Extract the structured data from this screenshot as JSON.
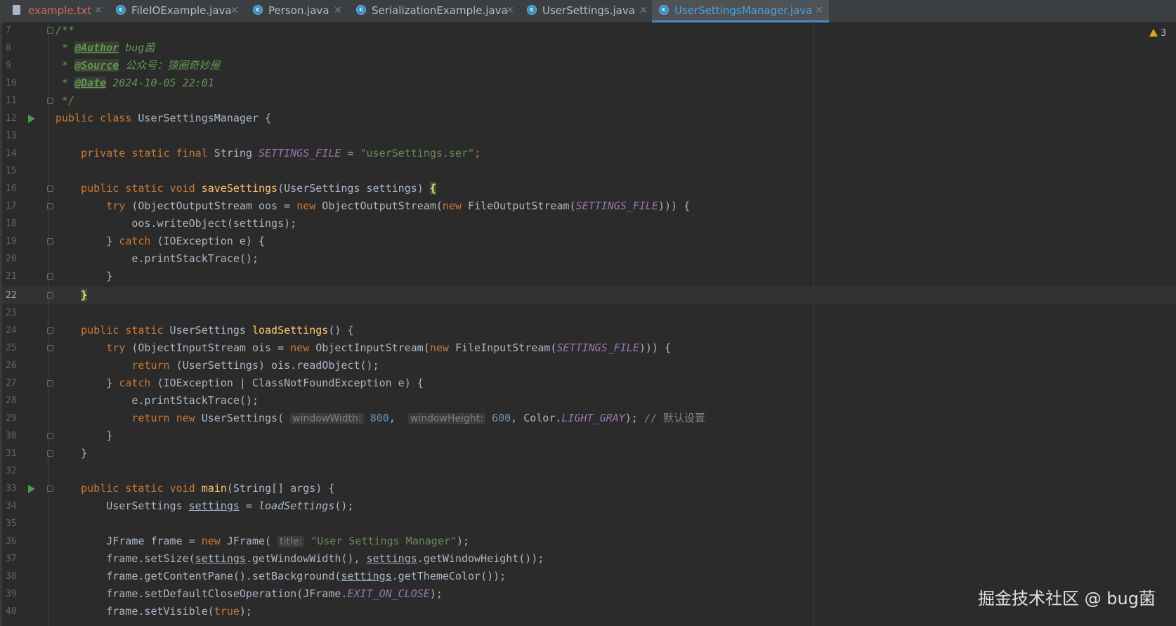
{
  "tabs": [
    {
      "label": "example.txt",
      "icon": "file-icon"
    },
    {
      "label": "FileIOExample.java",
      "icon": "java-class-icon"
    },
    {
      "label": "Person.java",
      "icon": "java-class-icon"
    },
    {
      "label": "SerializationExample.java",
      "icon": "java-class-icon"
    },
    {
      "label": "UserSettings.java",
      "icon": "java-class-icon"
    },
    {
      "label": "UserSettingsManager.java",
      "icon": "java-class-icon",
      "active": true
    }
  ],
  "warnings_count": "3",
  "watermark": "掘金技术社区 @ bug菌",
  "current_line": "22",
  "lines": [
    {
      "n": "7"
    },
    {
      "n": "8"
    },
    {
      "n": "9"
    },
    {
      "n": "10"
    },
    {
      "n": "11"
    },
    {
      "n": "12"
    },
    {
      "n": "13"
    },
    {
      "n": "14"
    },
    {
      "n": "15"
    },
    {
      "n": "16"
    },
    {
      "n": "17"
    },
    {
      "n": "18"
    },
    {
      "n": "19"
    },
    {
      "n": "20"
    },
    {
      "n": "21"
    },
    {
      "n": "22"
    },
    {
      "n": "23"
    },
    {
      "n": "24"
    },
    {
      "n": "25"
    },
    {
      "n": "26"
    },
    {
      "n": "27"
    },
    {
      "n": "28"
    },
    {
      "n": "29"
    },
    {
      "n": "30"
    },
    {
      "n": "31"
    },
    {
      "n": "32"
    },
    {
      "n": "33"
    },
    {
      "n": "34"
    },
    {
      "n": "35"
    },
    {
      "n": "36"
    },
    {
      "n": "37"
    },
    {
      "n": "38"
    },
    {
      "n": "39"
    },
    {
      "n": "40"
    }
  ],
  "tok": {
    "l7": "/**",
    "l8_a": " * ",
    "l8_tag": "@Author",
    "l8_b": " bug菌",
    "l9_a": " * ",
    "l9_tag": "@Source",
    "l9_b": " 公众号：猿圈奇妙屋",
    "l10_a": " * ",
    "l10_tag": "@Date",
    "l10_b": " 2024-10-05 22:01",
    "l11": " */",
    "public": "public",
    "class": "class",
    "private": "private",
    "static": "static",
    "final": "final",
    "void": "void",
    "try": "try",
    "new": "new",
    "catch": "catch",
    "return": "return",
    "true": "true",
    "l12_name": " UserSettingsManager {",
    "l14_type": " String ",
    "l14_const": "SETTINGS_FILE",
    "l14_eq": " = ",
    "l14_str": "\"userSettings.ser\"",
    "l14_end": ";",
    "l16_fn": "saveSettings",
    "l16_args": "(UserSettings settings) ",
    "l16_brace": "{",
    "l17_a": " (ObjectOutputStream oos = ",
    "l17_b": " ObjectOutputStream(",
    "l17_c": " FileOutputStream(",
    "l17_const": "SETTINGS_FILE",
    "l17_end": "))) {",
    "l18": "oos.writeObject(settings);",
    "l19_a": "} ",
    "l19_b": " (IOException e) {",
    "l20": "e.printStackTrace();",
    "l21": "}",
    "l22": "}",
    "l24_type": " UserSettings ",
    "l24_fn": "loadSettings",
    "l24_end": "() {",
    "l25_a": " (ObjectInputStream ois = ",
    "l25_b": " ObjectInputStream(",
    "l25_c": " FileInputStream(",
    "l25_const": "SETTINGS_FILE",
    "l25_end": "))) {",
    "l26_b": " (UserSettings) ois.readObject();",
    "l27_a": "} ",
    "l27_b": " (IOException | ClassNotFoundException e) {",
    "l28": "e.printStackTrace();",
    "l29_b": " UserSettings( ",
    "l29_h1": "windowWidth:",
    "l29_n1": "800",
    "l29_c1": ",  ",
    "l29_h2": "windowHeight:",
    "l29_n2": "600",
    "l29_c2": ", Color.",
    "l29_const": "LIGHT_GRAY",
    "l29_end": "); ",
    "l29_cmt": "// 默认设置",
    "l30": "}",
    "l31": "}",
    "l33_fn": "main",
    "l33_args": "(String[] args) {",
    "l34_a": "UserSettings ",
    "l34_var": "settings",
    "l34_b": " = ",
    "l34_fn": "loadSettings",
    "l34_end": "();",
    "l36_a": "JFrame frame = ",
    "l36_b": " JFrame( ",
    "l36_hint": "title:",
    "l36_str": "\"User Settings Manager\"",
    "l36_end": ");",
    "l37_a": "frame.setSize(",
    "l37_v1": "settings",
    "l37_b": ".getWindowWidth(), ",
    "l37_v2": "settings",
    "l37_c": ".getWindowHeight());",
    "l38_a": "frame.getContentPane().setBackground(",
    "l38_v": "settings",
    "l38_b": ".getThemeColor());",
    "l39_a": "frame.setDefaultCloseOperation(JFrame.",
    "l39_const": "EXIT_ON_CLOSE",
    "l39_end": ");",
    "l40_a": "frame.setVisible(",
    "l40_end": ");"
  }
}
